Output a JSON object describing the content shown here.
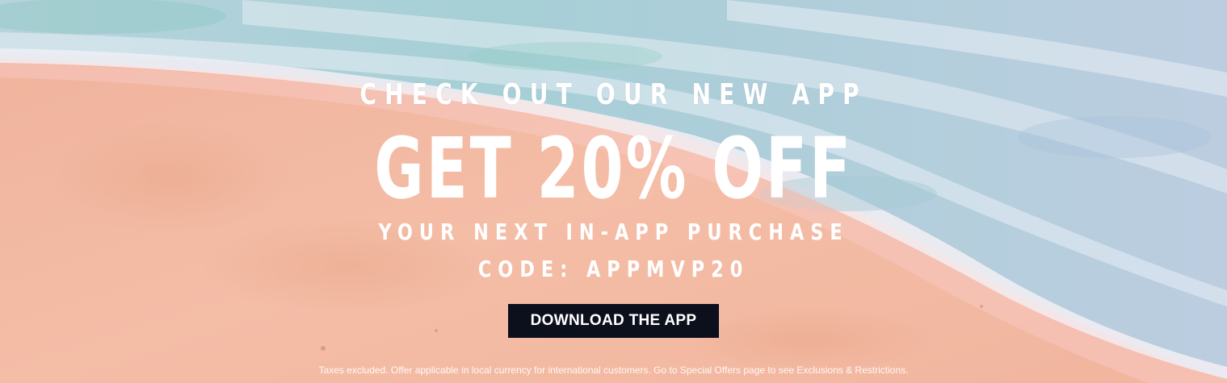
{
  "banner": {
    "eyebrow": "CHECK OUT OUR NEW APP",
    "headline": "GET 20% OFF",
    "subline": "YOUR NEXT IN-APP PURCHASE",
    "code": "CODE: APPMVP20",
    "cta_label": "DOWNLOAD THE APP",
    "disclaimer": "Taxes excluded. Offer applicable in local currency for international customers. Go to Special Offers page to see Exclusions & Restrictions."
  },
  "colors": {
    "sand": "#f1b6a0",
    "sea": "#9fc8d6",
    "foam": "#eef0f6",
    "button_bg": "#0c0f1c",
    "text": "#ffffff"
  }
}
